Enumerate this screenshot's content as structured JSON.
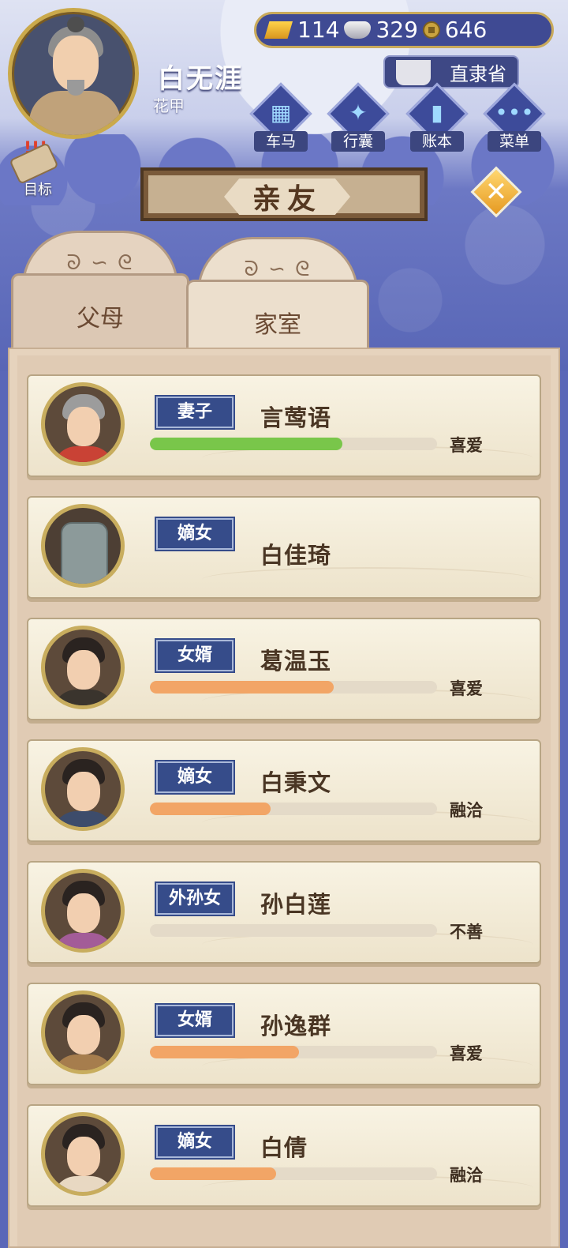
{
  "player": {
    "name": "白无涯",
    "age_label": "花甲"
  },
  "resources": {
    "gold": "114",
    "silver": "329",
    "coins": "646"
  },
  "location": "直隶省",
  "nav": [
    {
      "label": "车马",
      "glyph": "▦"
    },
    {
      "label": "行囊",
      "glyph": "✦"
    },
    {
      "label": "账本",
      "glyph": "▮"
    },
    {
      "label": "菜单",
      "glyph": "•••"
    }
  ],
  "goal_label": "目标",
  "title": "亲友",
  "close_glyph": "✕",
  "tabs": [
    {
      "label": "父母",
      "active": false
    },
    {
      "label": "家室",
      "active": true
    }
  ],
  "members": [
    {
      "role": "妻子",
      "name": "言莺语",
      "relation": "喜爱",
      "affinity": 0.67,
      "bar_color": "#79c64a",
      "avatar": {
        "hair": "#9c9c9c",
        "clothes": "#c94235"
      }
    },
    {
      "role": "嫡女",
      "name": "白佳琦",
      "relation": "",
      "affinity": null,
      "bar_color": "",
      "avatar": {
        "tombstone": true
      }
    },
    {
      "role": "女婿",
      "name": "葛温玉",
      "relation": "喜爱",
      "affinity": 0.64,
      "bar_color": "#f2a566",
      "avatar": {
        "hair": "#2a2320",
        "clothes": "#3a342d"
      }
    },
    {
      "role": "嫡女",
      "name": "白秉文",
      "relation": "融洽",
      "affinity": 0.42,
      "bar_color": "#f2a566",
      "avatar": {
        "hair": "#2a2320",
        "clothes": "#3d4c6b"
      }
    },
    {
      "role": "外孙女",
      "name": "孙白莲",
      "relation": "不善",
      "affinity": 0.0,
      "bar_color": "#f2a566",
      "avatar": {
        "hair": "#2a2320",
        "clothes": "#a35c98"
      }
    },
    {
      "role": "女婿",
      "name": "孙逸群",
      "relation": "喜爱",
      "affinity": 0.52,
      "bar_color": "#f2a566",
      "avatar": {
        "hair": "#2a2320",
        "clothes": "#a67d4d"
      }
    },
    {
      "role": "嫡女",
      "name": "白倩",
      "relation": "融洽",
      "affinity": 0.44,
      "bar_color": "#f2a566",
      "avatar": {
        "hair": "#2a2320",
        "clothes": "#e8d8c2"
      }
    }
  ],
  "colors": {
    "bar_green": "#79c64a",
    "bar_orange": "#f2a566",
    "tag_blue": "#364c8a",
    "frame_gold": "#c8ad5e"
  }
}
